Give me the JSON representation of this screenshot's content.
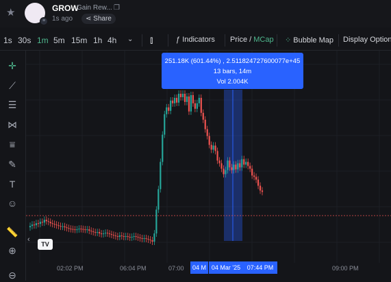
{
  "header": {
    "ticker": "GROW",
    "name": "Gain Rew...",
    "age": "1s ago",
    "share_label": "Share"
  },
  "toolbar": {
    "timeframes": [
      "1s",
      "30s",
      "1m",
      "5m",
      "15m",
      "1h",
      "4h"
    ],
    "active_timeframe": "1m",
    "indicators_label": "Indicators",
    "price_label": "Price",
    "price_sep": " / ",
    "mcap_label": "MCap",
    "bubble_label": "Bubble Map",
    "display_label": "Display Options"
  },
  "colors": {
    "up": "#26a69a",
    "down": "#ef5350",
    "accent": "#2962ff",
    "active": "#4fb98f"
  },
  "tooltip": {
    "line1": "251.18K (601.44%) , 2.511824727600077e+45",
    "line2": "13 bars, 14m",
    "line3": "Vol 2.004K"
  },
  "x_axis": {
    "ticks": [
      "02:02 PM",
      "06:04 PM",
      "07:00",
      "09:00 PM"
    ],
    "highlight_start": "04 M",
    "highlight_date": "04 Mar '25",
    "highlight_end": "07:44 PM"
  },
  "tools": [
    "crosshair-icon",
    "trendline-icon",
    "fib-icon",
    "pattern-icon",
    "measure-lines-icon",
    "brush-icon",
    "text-icon",
    "emoji-icon",
    "ruler-icon",
    "zoom-icon"
  ],
  "chart_data": {
    "type": "candlestick",
    "note_text": "",
    "closes": [
      0.6,
      0.8,
      0.7,
      1.0,
      0.9,
      1.2,
      1.1,
      1.5,
      1.3,
      1.2,
      1.0,
      0.9,
      0.8,
      0.7,
      0.6,
      0.5,
      0.55,
      0.4,
      0.3,
      0.2,
      0.15,
      0.1,
      0.05,
      0.1,
      0.2,
      0.15,
      0.1,
      0.05,
      0.1,
      -0.1,
      -0.2,
      -0.3,
      -0.4,
      -0.3,
      -0.5,
      -0.6,
      -0.5,
      -0.4,
      -0.5,
      -0.6,
      -0.7,
      -0.8,
      -0.9,
      -1.0,
      -0.8,
      -0.9,
      -1.0,
      -0.9,
      -1.0,
      -1.1,
      -1.0,
      -0.9,
      -1.0,
      -1.1,
      -1.2,
      -1.3,
      -1.2,
      -1.3,
      -1.4,
      -1.5,
      -1.7,
      -0.5,
      3.0,
      6.0,
      10.0,
      14.0,
      17.0,
      18.0,
      17.5,
      19.0,
      18.6,
      19.4,
      18.7,
      20.0,
      19.5,
      20.0,
      18.8,
      19.6,
      17.4,
      19.8,
      18.6,
      17.8,
      18.6,
      19.4,
      17.2,
      16.2,
      14.8,
      13.8,
      12.5,
      11.8,
      12.4,
      11.6,
      10.2,
      9.8,
      9.0,
      8.2,
      8.8,
      10.2,
      9.2,
      8.8,
      9.6,
      8.9,
      9.8,
      9.2,
      10.4,
      9.6,
      10.0,
      9.4,
      9.0,
      8.0,
      7.8,
      7.4,
      6.5,
      5.8,
      5.6
    ]
  }
}
